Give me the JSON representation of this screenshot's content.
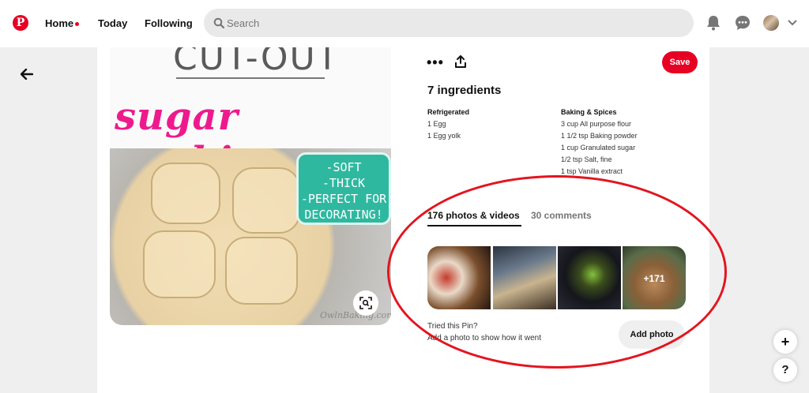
{
  "colors": {
    "brand": "#e60023",
    "annotation": "#e3151f"
  },
  "nav": {
    "logo_icon": "pinterest-logo",
    "home": "Home",
    "today": "Today",
    "following": "Following",
    "search_placeholder": "Search",
    "icons": [
      "bell-icon",
      "chat-icon",
      "avatar",
      "chevron-down-icon"
    ]
  },
  "pin_image": {
    "title_line1": "CUT-OUT",
    "title_line2": "sugar cookies",
    "badge": [
      "-SOFT",
      "-THICK",
      "-PERFECT FOR",
      "DECORATING!"
    ],
    "watermark": "OwlnBaking.com"
  },
  "actions": {
    "more": "•••",
    "save": "Save"
  },
  "ingredients": {
    "title": "7 ingredients",
    "groups": [
      {
        "name": "Refrigerated",
        "items": [
          "1 Egg",
          "1 Egg yolk"
        ]
      },
      {
        "name": "Baking & Spices",
        "items": [
          "3 cup All purpose flour",
          "1 1/2 tsp Baking powder",
          "1 cup Granulated sugar",
          "1/2 tsp Salt, fine",
          "1 tsp Vanilla extract"
        ]
      }
    ]
  },
  "tabs": [
    {
      "label": "176 photos & videos",
      "active": true
    },
    {
      "label": "30 comments",
      "active": false
    }
  ],
  "photos": {
    "more_count": "+171"
  },
  "tried": {
    "title": "Tried this Pin?",
    "subtitle": "Add a photo to show how it went",
    "button": "Add photo"
  },
  "fab": {
    "plus": "+",
    "help": "?"
  }
}
